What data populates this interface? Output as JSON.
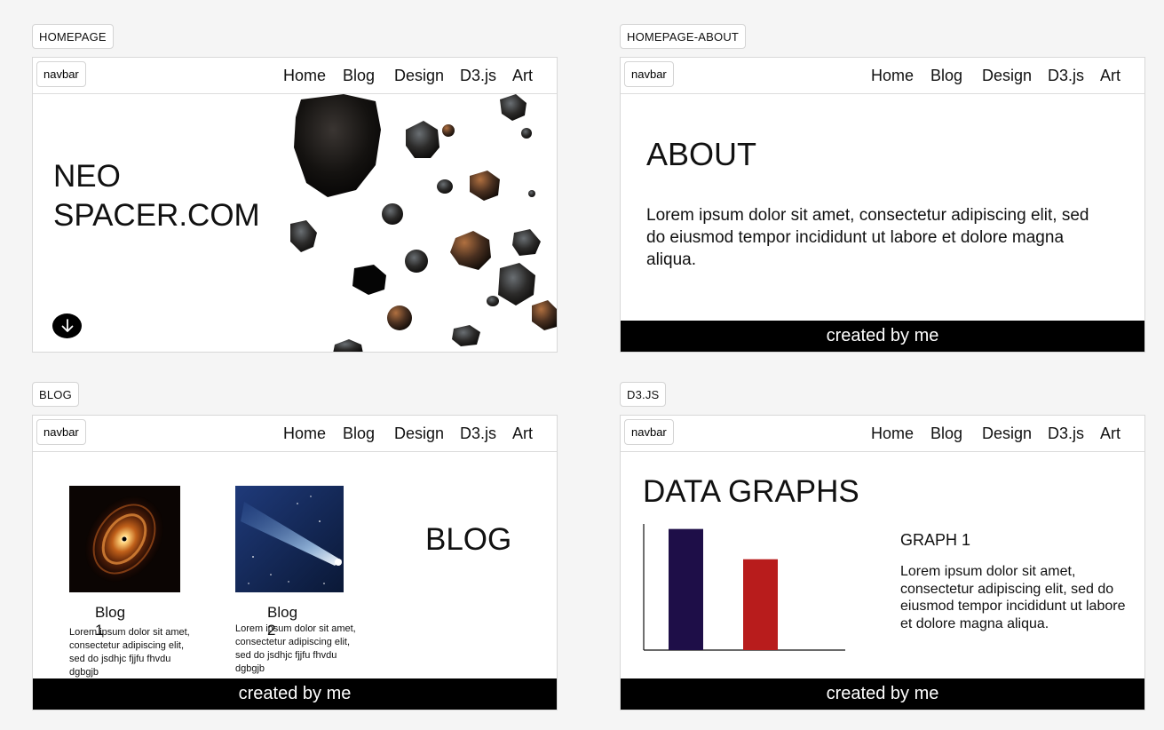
{
  "labels": {
    "homepage": "HOMEPAGE",
    "about": "HOMEPAGE-ABOUT",
    "blog": "BLOG",
    "d3": "D3.JS"
  },
  "navbar": {
    "chip": "navbar",
    "links": [
      "Home",
      "Blog",
      "Design",
      "D3.js",
      "Art"
    ]
  },
  "footer": {
    "text": "created by me"
  },
  "homepage": {
    "title_line1": "NEO",
    "title_line2": "SPACER.COM",
    "scroll_icon": "arrow-down-icon"
  },
  "about": {
    "title": "ABOUT",
    "body": "Lorem ipsum dolor sit amet, consectetur adipiscing elit, sed do eiusmod tempor incididunt ut labore et dolore magna aliqua."
  },
  "blog": {
    "title": "BLOG",
    "cards": [
      {
        "title": "Blog 1",
        "body": "Lorem ipsum dolor sit amet, consectetur adipiscing elit, sed do jsdhjc fjjfu fhvdu dgbgjb"
      },
      {
        "title": "Blog 2",
        "body": "Lorem ipsum dolor sit amet, consectetur adipiscing elit, sed do jsdhjc fjjfu fhvdu dgbgjb"
      }
    ]
  },
  "d3": {
    "title": "DATA GRAPHS",
    "graph_title": "GRAPH 1",
    "graph_body": "Lorem ipsum dolor sit amet, consectetur adipiscing elit, sed do eiusmod tempor incididunt ut labore et dolore magna aliqua.",
    "chart_data": {
      "type": "bar",
      "values": [
        100,
        75
      ],
      "ylim": [
        0,
        110
      ],
      "colors": [
        "#1e0e48",
        "#b81c1c"
      ]
    }
  }
}
